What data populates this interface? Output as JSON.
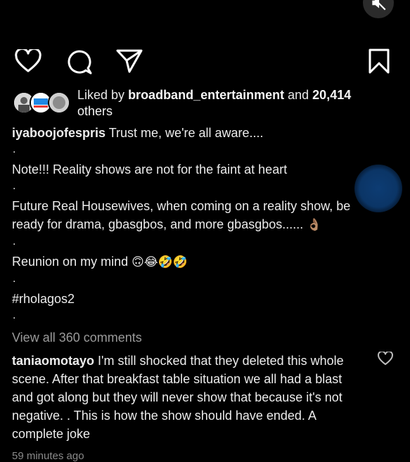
{
  "post": {
    "liked_by_prefix": "Liked by",
    "liked_by_user": "broadband_entertainment",
    "liked_by_and": "and",
    "likes_count": "20,414",
    "likes_suffix": "others",
    "caption_user": "iyaboojofespris",
    "caption_lines": [
      "Trust me, we're all aware....",
      ".",
      "Note!!! Reality shows are not for the faint at heart",
      ".",
      "Future Real Housewives, when coming on a reality show, be ready for drama, gbasgbos, and more gbasgbos......",
      ".",
      "Reunion on my mind",
      ".",
      "#rholagos2",
      "."
    ],
    "emoji_ok": "👌🏽",
    "emoji_reunion": "🙃😂🤣🤣",
    "view_all_comments": "View all 360 comments",
    "top_comment": {
      "user": "taniaomotayo",
      "text": "I'm still shocked that they deleted this whole scene. After that breakfast table situation we all had a blast and got along but they will never show that because it's not negative. . This is how the show should have ended. A complete joke"
    },
    "timestamp": "59 minutes ago"
  },
  "icons": {
    "mute": "muted-speaker-icon",
    "like": "heart-icon",
    "comment": "comment-bubble-icon",
    "share": "send-icon",
    "save": "bookmark-icon",
    "comment_like": "small-heart-icon"
  },
  "colors": {
    "background": "#000000",
    "text": "#f5f5f5",
    "muted": "#9a9a9a",
    "accent_blue": "#0b3566"
  }
}
